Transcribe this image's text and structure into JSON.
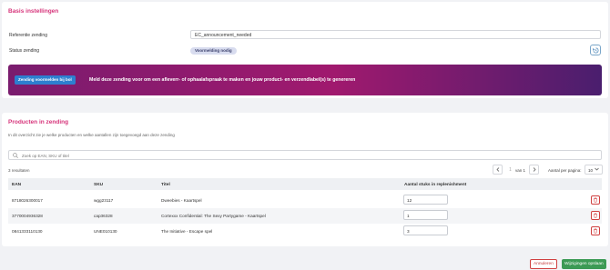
{
  "basis": {
    "title": "Basis instellingen",
    "reference_label": "Referentie zending",
    "reference_value": "EC_announcement_needed",
    "status_label": "Status zending",
    "status_badge": "Voormelding nodig"
  },
  "banner": {
    "button_label": "Zending voormelden bij bol",
    "text": "Meld deze zending voor om een afleverr- of ophaalafspraak te maken en jouw product- en verzendlabel(s) te genereren"
  },
  "products": {
    "title": "Producten in zending",
    "intro": "In dit overzicht zie je welke producten en welke aantallen zijn toegevoegd aan deze zending",
    "search_placeholder": "Zoek op EAN, SKU of titel",
    "results_count": "3 resultaten",
    "pager": {
      "current_page": "1",
      "of_label": "van 1",
      "per_page_label": "Aantal per pagina:",
      "per_page_value": "10"
    },
    "columns": [
      "EAN",
      "SKU",
      "Titel",
      "Aantal stuks in replenishment"
    ],
    "rows": [
      {
        "ean": "8718026300017",
        "sku": "wgg23117",
        "title": "Dweebies - Kaartspel",
        "qty": "12"
      },
      {
        "ean": "3770004936328",
        "sku": "cap36328",
        "title": "Cortexxx Confidential: The Sexy Partygame - Kaartspel",
        "qty": "1"
      },
      {
        "ean": "0841333110130",
        "sku": "UNE010130",
        "title": "The Initiative - Escape spel",
        "qty": "3"
      }
    ]
  },
  "footer": {
    "cancel_label": "Annuleren",
    "save_label": "Wijzigingen opslaan"
  },
  "colors": {
    "accent": "#d6337a",
    "banner_gradient": [
      "#7a1c6e",
      "#a0196e",
      "#4a1e6e"
    ],
    "primary_button": "#2d7fcf",
    "save_button": "#3c9a55",
    "danger": "#d04040"
  },
  "icons": {
    "history": "history-icon",
    "search": "search-icon",
    "prev": "chevron-left-icon",
    "next": "chevron-right-icon",
    "dropdown": "chevron-down-icon",
    "delete": "trash-icon"
  }
}
